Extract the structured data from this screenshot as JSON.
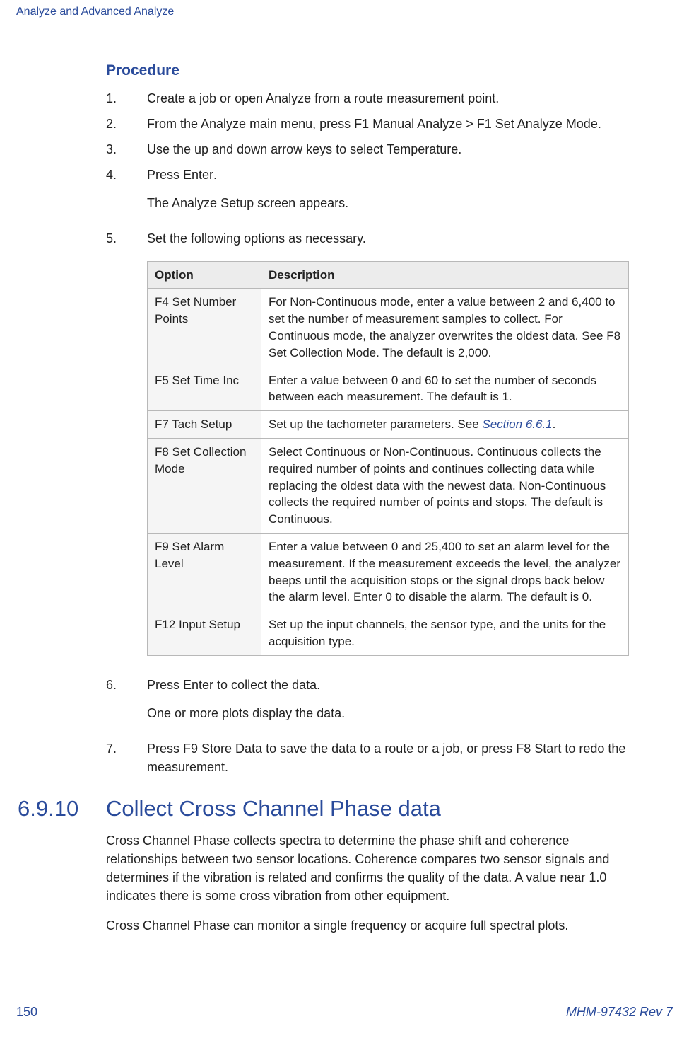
{
  "header": {
    "title": "Analyze and Advanced Analyze"
  },
  "procedure": {
    "heading": "Procedure",
    "steps": [
      {
        "num": "1.",
        "text": "Create a job or open Analyze from a route measurement point."
      },
      {
        "num": "2.",
        "prefix": "From the Analyze main menu, press ",
        "ui1": "F1 Manual Analyze",
        "sep": " > ",
        "ui2": "F1 Set Analyze Mode",
        "suffix": "."
      },
      {
        "num": "3.",
        "prefix": "Use the up and down arrow keys to select ",
        "ui1": "Temperature",
        "suffix": "."
      },
      {
        "num": "4.",
        "prefix": "Press ",
        "ui1": "Enter",
        "suffix": ".",
        "extra": "The Analyze Setup screen appears."
      },
      {
        "num": "5.",
        "text": "Set the following options as necessary."
      },
      {
        "num": "6.",
        "prefix": "Press ",
        "ui1": "Enter",
        "suffix": " to collect the data.",
        "extra": "One or more plots display the data."
      },
      {
        "num": "7.",
        "prefix": "Press ",
        "ui1": "F9 Store Data",
        "mid": " to save the data to a route or a job, or press ",
        "ui2": "F8 Start",
        "suffix": " to redo the measurement."
      }
    ]
  },
  "table": {
    "head_option": "Option",
    "head_desc": "Description",
    "rows": [
      {
        "opt": "F4 Set Number Points",
        "parts": [
          "For ",
          "Non-Continuous",
          " mode, enter a value between 2 and 6,400 to set the number of measurement samples to collect. For ",
          "Continuous",
          " mode, the analyzer overwrites the oldest data. See ",
          "F8 Set Collection Mode",
          ". The default is 2,000."
        ]
      },
      {
        "opt": "F5 Set Time Inc",
        "parts": [
          "Enter a value between 0 and 60 to set the number of seconds between each measurement. The default is 1."
        ]
      },
      {
        "opt": "F7 Tach Setup",
        "parts": [
          "Set up the tachometer parameters. See "
        ],
        "link": "Section 6.6.1",
        "after_link": "."
      },
      {
        "opt": "F8 Set Collection Mode",
        "parts": [
          "Select ",
          "Continuous",
          " or ",
          "Non-Continuous",
          ". ",
          "Continuous",
          " collects the required number of points and continues collecting data while replacing the oldest data with the newest data. ",
          "Non-Continuous",
          " collects the required number of points and stops. The default is ",
          "Continuous",
          "."
        ]
      },
      {
        "opt": "F9 Set Alarm Level",
        "parts": [
          "Enter a value between 0 and 25,400 to set an alarm level for the measurement. If the measurement exceeds the level, the analyzer beeps until the acquisition stops or the signal drops back below the alarm level. Enter 0 to disable the alarm. The default is 0."
        ]
      },
      {
        "opt": "F12 Input Setup",
        "parts": [
          "Set up the input channels, the sensor type, and the units for the acquisition type."
        ]
      }
    ]
  },
  "section": {
    "num": "6.9.10",
    "title": "Collect Cross Channel Phase data",
    "p1_prefix": "Cross Channel Phase",
    "p1_rest": " collects spectra to determine the phase shift and coherence relationships between two sensor locations. Coherence compares two sensor signals and determines if the vibration is related and confirms the quality of the data. A value near 1.0 indicates there is some cross vibration from other equipment.",
    "p2_prefix": "Cross Channel Phase",
    "p2_rest": " can monitor a single frequency or acquire full spectral plots."
  },
  "footer": {
    "page": "150",
    "rev": "MHM-97432 Rev 7"
  }
}
